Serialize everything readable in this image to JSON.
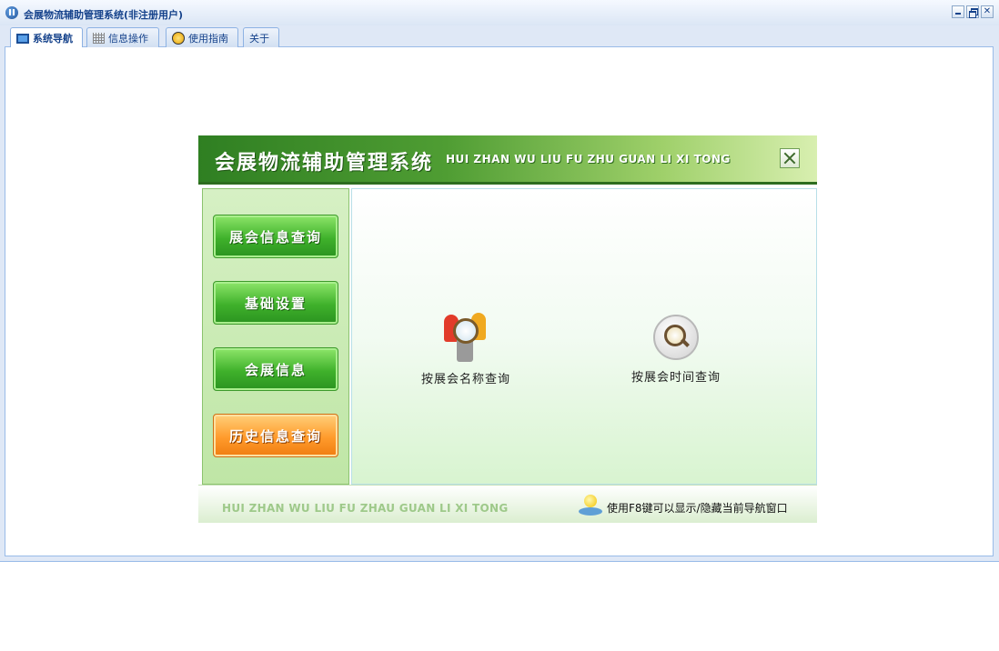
{
  "window": {
    "title": "会展物流辅助管理系统(非注册用户)",
    "controls": [
      "minimize",
      "restore",
      "close"
    ]
  },
  "tabs": [
    {
      "label": "系统导航",
      "icon": "monitor-icon",
      "active": true
    },
    {
      "label": "信息操作",
      "icon": "grid-icon",
      "active": false
    },
    {
      "label": "使用指南",
      "icon": "help-icon",
      "active": false
    },
    {
      "label": "关于",
      "icon": "",
      "active": false
    }
  ],
  "nav_panel": {
    "title": "会展物流辅助管理系统",
    "subtitle": "HUI ZHAN WU LIU FU ZHU GUAN LI XI TONG",
    "menu": [
      {
        "label": "展会信息查询",
        "style": "green"
      },
      {
        "label": "基础设置",
        "style": "green"
      },
      {
        "label": "会展信息",
        "style": "green"
      },
      {
        "label": "历史信息查询",
        "style": "orange",
        "selected": true
      }
    ],
    "features": [
      {
        "label": "按展会名称查询",
        "icon": "person-search-icon"
      },
      {
        "label": "按展会时间查询",
        "icon": "time-search-icon"
      }
    ],
    "footer": {
      "pinyin": "HUI ZHAN WU LIU FU ZHAU  GUAN LI XI TONG",
      "tip": "使用F8键可以显示/隐藏当前导航窗口"
    }
  },
  "colors": {
    "header_green": "#4f9d33",
    "menu_green": "#3fb12b",
    "menu_orange": "#ff9b2c",
    "frame_blue": "#99bbe8",
    "title_blue": "#15428b"
  }
}
